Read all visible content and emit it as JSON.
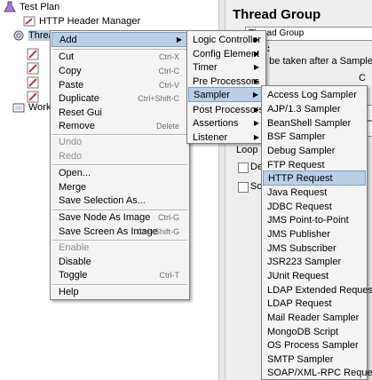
{
  "tree": {
    "test_plan": "Test Plan",
    "http_header_manager": "HTTP Header Manager",
    "thread_group": "Thread Group",
    "workbench": "WorkBench"
  },
  "panel": {
    "title": "Thread Group",
    "name_label": "N:",
    "name_value": "Thread Group",
    "comments_label": "ents:",
    "action_text": "o be taken after a Sampler e",
    "radio_letter": "C",
    "loop_label": "Loop C",
    "del_label": "Del",
    "sch_label": "Sch"
  },
  "context_menu": {
    "items": [
      {
        "label": "Add",
        "shortcut": "",
        "arrow": "▶"
      },
      {
        "label": "Cut",
        "shortcut": "Ctrl-X"
      },
      {
        "label": "Copy",
        "shortcut": "Ctrl-C"
      },
      {
        "label": "Paste",
        "shortcut": "Ctrl-V"
      },
      {
        "label": "Duplicate",
        "shortcut": "Ctrl+Shift-C"
      },
      {
        "label": "Reset Gui",
        "shortcut": ""
      },
      {
        "label": "Remove",
        "shortcut": "Delete"
      },
      {
        "label": "Undo",
        "shortcut": ""
      },
      {
        "label": "Redo",
        "shortcut": ""
      },
      {
        "label": "Open...",
        "shortcut": ""
      },
      {
        "label": "Merge",
        "shortcut": ""
      },
      {
        "label": "Save Selection As...",
        "shortcut": ""
      },
      {
        "label": "Save Node As Image",
        "shortcut": "Ctrl-G"
      },
      {
        "label": "Save Screen As Image",
        "shortcut": "Ctrl+Shift-G"
      },
      {
        "label": "Enable",
        "shortcut": ""
      },
      {
        "label": "Disable",
        "shortcut": ""
      },
      {
        "label": "Toggle",
        "shortcut": "Ctrl-T"
      },
      {
        "label": "Help",
        "shortcut": ""
      }
    ]
  },
  "add_menu": {
    "items": [
      {
        "label": "Logic Controller"
      },
      {
        "label": "Config Element"
      },
      {
        "label": "Timer"
      },
      {
        "label": "Pre Processors"
      },
      {
        "label": "Sampler"
      },
      {
        "label": "Post Processors"
      },
      {
        "label": "Assertions"
      },
      {
        "label": "Listener"
      }
    ]
  },
  "sampler_menu": {
    "items": [
      {
        "label": "Access Log Sampler"
      },
      {
        "label": "AJP/1.3 Sampler"
      },
      {
        "label": "BeanShell Sampler"
      },
      {
        "label": "BSF Sampler"
      },
      {
        "label": "Debug Sampler"
      },
      {
        "label": "FTP Request"
      },
      {
        "label": "HTTP Request"
      },
      {
        "label": "Java Request"
      },
      {
        "label": "JDBC Request"
      },
      {
        "label": "JMS Point-to-Point"
      },
      {
        "label": "JMS Publisher"
      },
      {
        "label": "JMS Subscriber"
      },
      {
        "label": "JSR223 Sampler"
      },
      {
        "label": "JUnit Request"
      },
      {
        "label": "LDAP Extended Request"
      },
      {
        "label": "LDAP Request"
      },
      {
        "label": "Mail Reader Sampler"
      },
      {
        "label": "MongoDB Script"
      },
      {
        "label": "OS Process Sampler"
      },
      {
        "label": "SMTP Sampler"
      },
      {
        "label": "SOAP/XML-RPC Request"
      }
    ]
  },
  "colors": {
    "menu_bg": "#f4f4f4",
    "selection": "#b8cfe5",
    "disabled_text": "#8f8f8f"
  }
}
